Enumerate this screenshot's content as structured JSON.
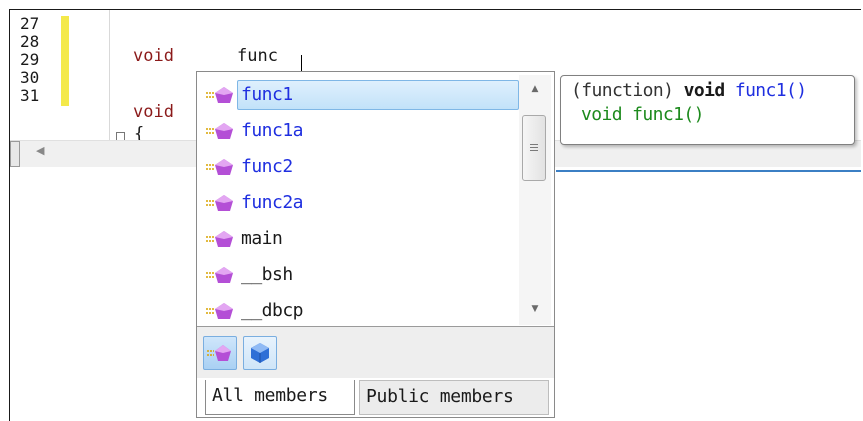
{
  "editor": {
    "line_numbers": [
      "27",
      "28",
      "29",
      "30",
      "31"
    ],
    "lines": [
      {
        "keyword": "void",
        "text": "func"
      },
      {
        "keyword": "void",
        "text": ""
      }
    ],
    "fold_text": "{"
  },
  "completion": {
    "items": [
      {
        "label": "func1",
        "icon": "method-icon",
        "selected": true,
        "blue": true
      },
      {
        "label": "func1a",
        "icon": "method-icon",
        "selected": false,
        "blue": true
      },
      {
        "label": "func2",
        "icon": "method-icon",
        "selected": false,
        "blue": true
      },
      {
        "label": "func2a",
        "icon": "method-icon",
        "selected": false,
        "blue": true
      },
      {
        "label": "main",
        "icon": "method-icon",
        "selected": false,
        "blue": false
      },
      {
        "label": "__bsh",
        "icon": "method-icon",
        "selected": false,
        "blue": false
      },
      {
        "label": "__dbcp",
        "icon": "method-icon",
        "selected": false,
        "blue": false
      }
    ],
    "filter_buttons": [
      {
        "name": "methods-filter",
        "icon": "method-filter-icon"
      },
      {
        "name": "types-filter",
        "icon": "type-filter-icon"
      }
    ],
    "tabs": [
      {
        "label": "All members",
        "active": true
      },
      {
        "label": "Public members",
        "active": false
      }
    ]
  },
  "tooltip": {
    "kind": "(function)",
    "return_type": "void",
    "name": "func1()",
    "signature": "void func1()"
  },
  "colors": {
    "keyword": "#8b1a1a",
    "identifier": "#1f2fe0",
    "signature": "#1d8a1d",
    "change_bar": "#f4e94a"
  }
}
